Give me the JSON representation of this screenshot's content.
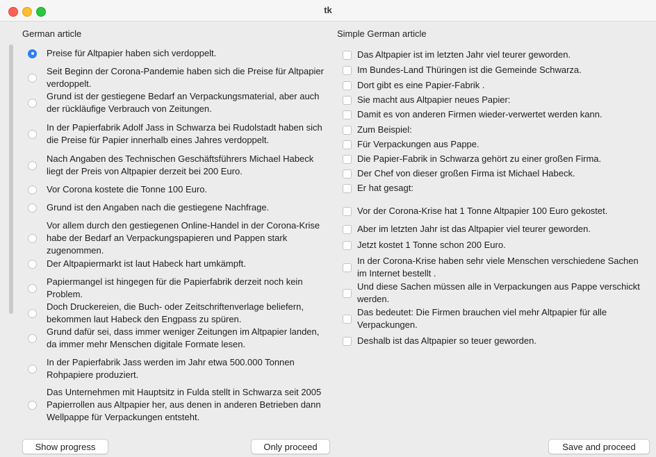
{
  "window": {
    "title": "tk"
  },
  "left": {
    "label": "German article",
    "selected_index": 0,
    "items": [
      "Preise für Altpapier haben sich verdoppelt.",
      "Seit Beginn der Corona-Pandemie haben sich die Preise für Altpapier verdoppelt.",
      "Grund ist der gestiegene Bedarf an Verpackungsmaterial, aber auch der rückläufige Verbrauch von Zeitungen.",
      "In der Papierfabrik Adolf Jass in Schwarza bei Rudolstadt haben sich die Preise für Papier innerhalb eines Jahres verdoppelt.",
      "Nach Angaben des Technischen Geschäftsführers Michael Habeck liegt der Preis von Altpapier derzeit bei 200 Euro.",
      "Vor Corona kostete die Tonne 100 Euro.",
      "Grund ist den Angaben nach die gestiegene Nachfrage.",
      "Vor allem durch den gestiegenen Online-Handel in der Corona-Krise habe der Bedarf an Verpackungspapieren und Pappen stark zugenommen.",
      "Der Altpapiermarkt ist laut Habeck hart umkämpft.",
      "Papiermangel ist hingegen für die Papierfabrik derzeit noch kein Problem.",
      "Doch Druckereien, die Buch- oder Zeitschriftenverlage beliefern, bekommen laut Habeck den Engpass zu spüren.",
      "Grund dafür sei, dass immer weniger Zeitungen im Altpapier landen, da immer mehr Menschen digitale Formate lesen.",
      "In der Papierfabrik Jass werden im Jahr etwa 500.000 Tonnen Rohpapiere produziert.",
      "Das Unternehmen mit Hauptsitz in Fulda stellt in Schwarza seit 2005 Papierrollen aus Altpapier her, aus denen in anderen Betrieben dann Wellpappe für Verpackungen entsteht."
    ]
  },
  "right": {
    "label": "Simple German article",
    "items": [
      "Das Altpapier ist im letzten Jahr viel teurer geworden.",
      "Im Bundes-Land Thüringen ist die Gemeinde Schwarza.",
      "Dort gibt es eine Papier-Fabrik .",
      "Sie macht aus Altpapier neues Papier:",
      "Damit es von anderen Firmen wieder-verwertet werden kann.",
      "Zum Beispiel:",
      "Für Verpackungen aus Pappe.",
      "Die Papier-Fabrik in Schwarza gehört zu einer großen Firma.",
      "Der Chef von dieser großen Firma ist Michael Habeck.",
      "Er hat gesagt:",
      "Vor der Corona-Krise hat 1 Tonne Altpapier 100 Euro gekostet.",
      "Aber im letzten Jahr ist das Altpapier viel teurer geworden.",
      "Jetzt kostet 1 Tonne schon 200 Euro.",
      "In der Corona-Krise haben sehr viele Menschen verschiedene Sachen im Internet bestellt .",
      "Und diese Sachen müssen alle in Verpackungen aus Pappe verschickt werden.",
      "Das bedeutet: Die Firmen brauchen viel mehr Altpapier für alle Verpackungen.",
      "Deshalb ist das Altpapier so teuer geworden."
    ]
  },
  "buttons": {
    "show_progress": "Show progress",
    "only_proceed": "Only proceed",
    "save_and_proceed": "Save and proceed"
  }
}
